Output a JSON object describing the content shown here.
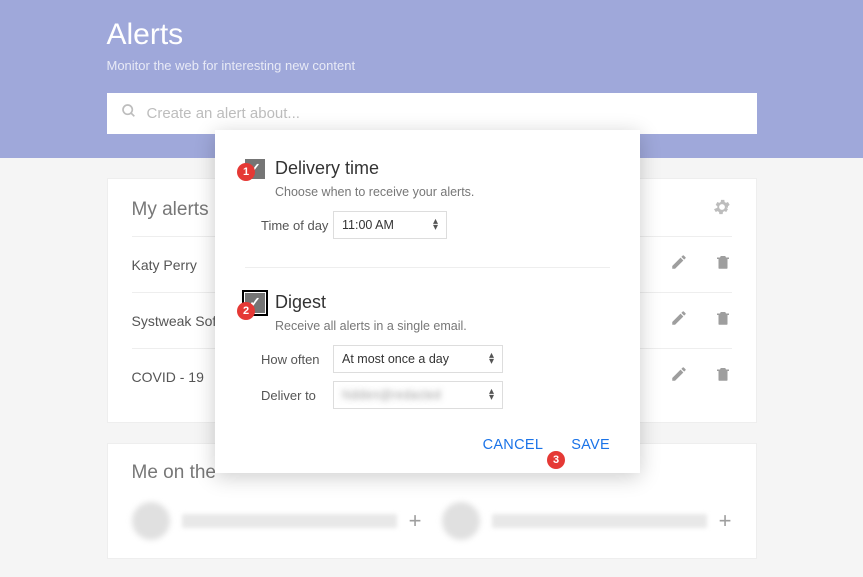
{
  "header": {
    "title": "Alerts",
    "subtitle": "Monitor the web for interesting new content",
    "search_placeholder": "Create an alert about..."
  },
  "my_alerts": {
    "title": "My alerts (",
    "items": [
      {
        "name": "Katy Perry"
      },
      {
        "name": "Systweak Soft"
      },
      {
        "name": "COVID - 19"
      }
    ]
  },
  "me_on_web": {
    "title": "Me on the"
  },
  "dialog": {
    "delivery": {
      "title": "Delivery time",
      "desc": "Choose when to receive your alerts.",
      "time_label": "Time of day",
      "time_value": "11:00 AM",
      "checked": true
    },
    "digest": {
      "title": "Digest",
      "desc": "Receive all alerts in a single email.",
      "how_often_label": "How often",
      "how_often_value": "At most once a day",
      "deliver_to_label": "Deliver to",
      "deliver_to_value": "",
      "checked": true
    },
    "cancel": "CANCEL",
    "save": "SAVE"
  },
  "badges": {
    "b1": "1",
    "b2": "2",
    "b3": "3"
  }
}
